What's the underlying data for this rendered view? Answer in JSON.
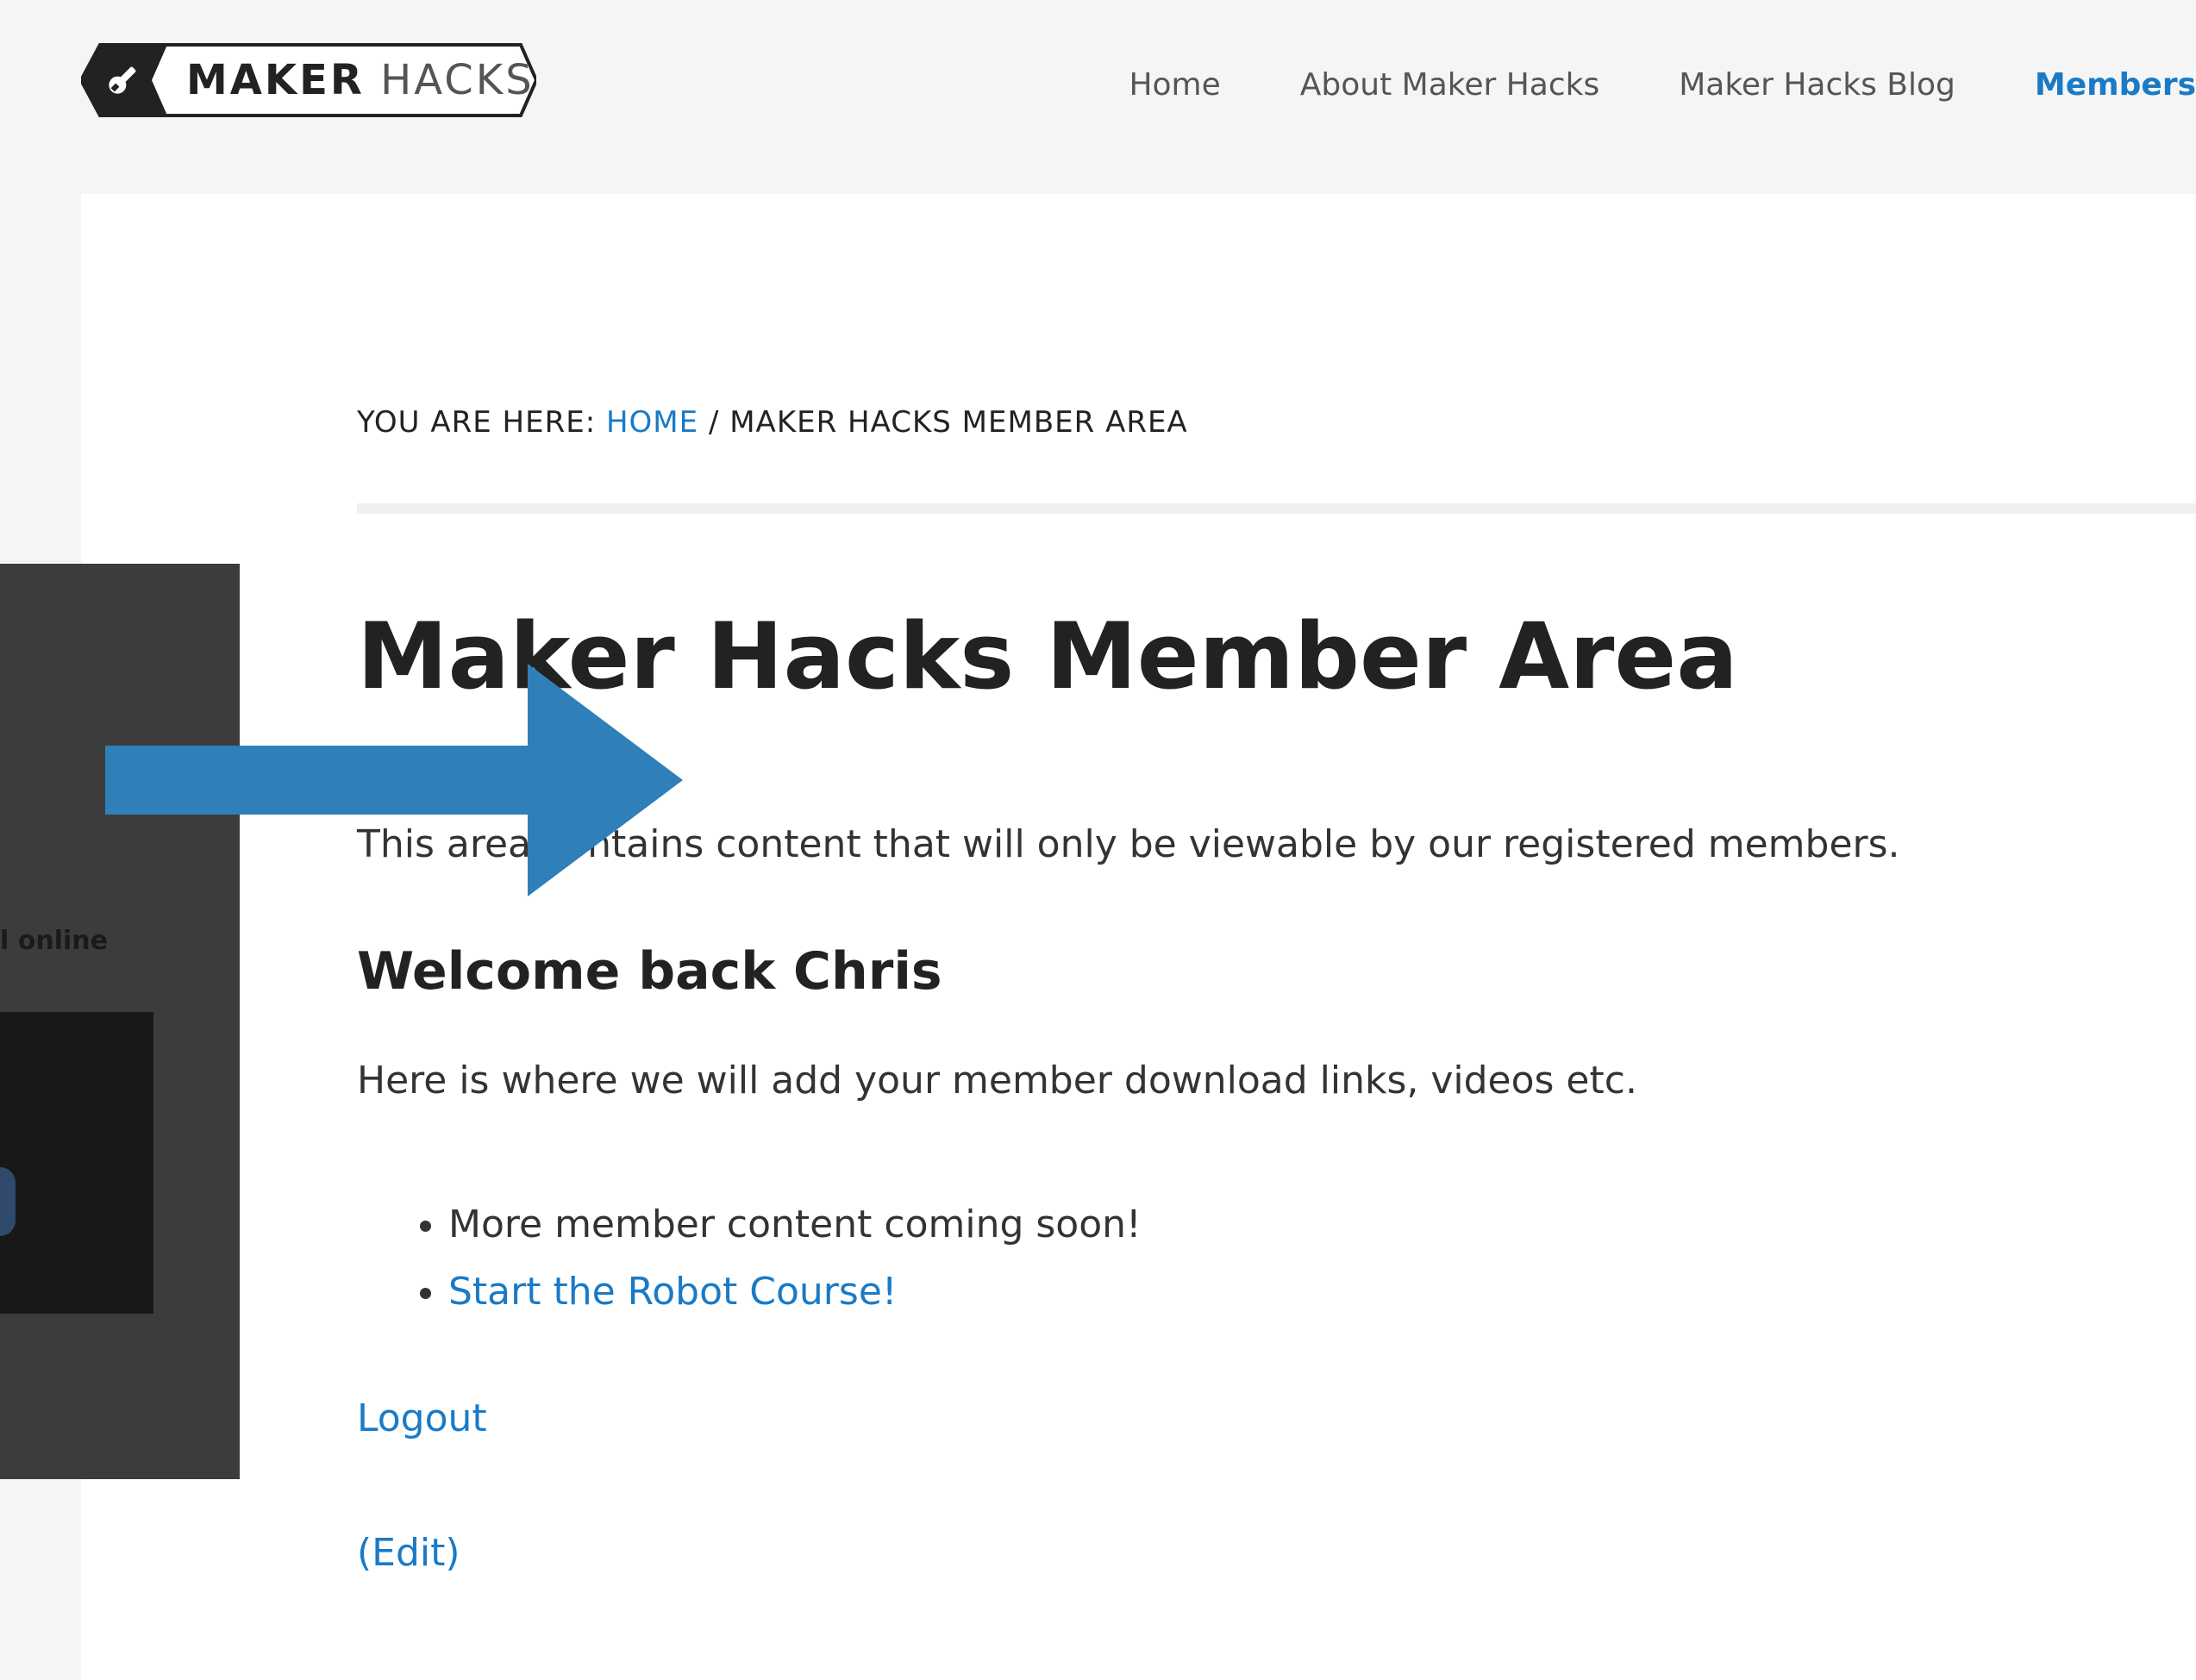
{
  "header": {
    "logo": {
      "word_bold": "MAKER",
      "word_light": "HACKS"
    },
    "nav": [
      {
        "label": "Home"
      },
      {
        "label": "About Maker Hacks"
      },
      {
        "label": "Maker Hacks Blog"
      },
      {
        "label": "Members",
        "active": true
      }
    ]
  },
  "breadcrumb": {
    "prefix": "YOU ARE HERE:",
    "home": "HOME",
    "separator": "/",
    "current": "MAKER HACKS MEMBER AREA"
  },
  "page": {
    "title": "Maker Hacks Member Area",
    "intro": "This area contains content that will only be viewable by our registered members.",
    "welcome": "Welcome back Chris",
    "body": "Here is where we will add your member download links, videos etc.",
    "list": [
      {
        "text": "More member content coming soon!",
        "link": false
      },
      {
        "text": "Start the Robot Course!",
        "link": true
      }
    ],
    "logout": "Logout",
    "edit": "(Edit)"
  },
  "overlay": {
    "panel_label": "l online"
  },
  "colors": {
    "accent": "#1a7ac6",
    "arrow": "#2f7fb8",
    "panel": "#3c3c3c",
    "header_bg": "#f5f5f5"
  }
}
